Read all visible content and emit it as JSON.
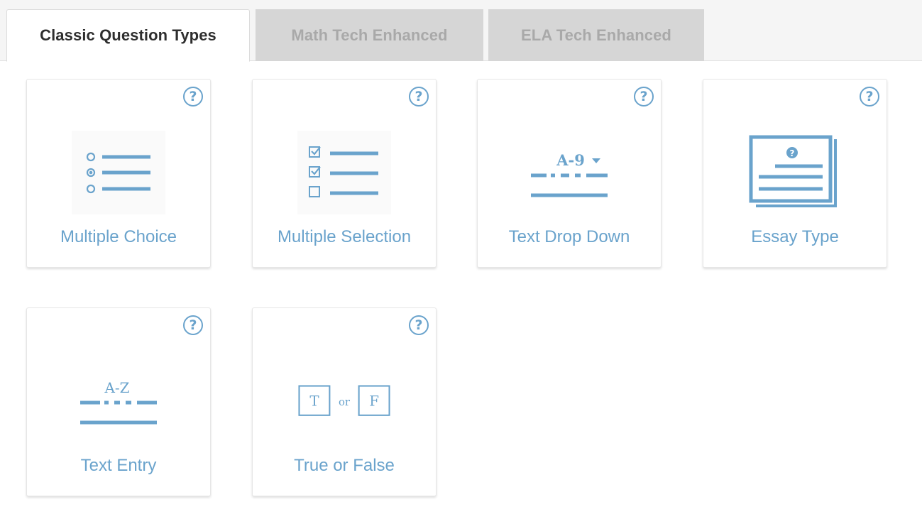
{
  "tabs": [
    {
      "label": "Classic Question Types",
      "active": true
    },
    {
      "label": "Math Tech Enhanced",
      "active": false
    },
    {
      "label": "ELA Tech Enhanced",
      "active": false
    }
  ],
  "help_glyph": "?",
  "cards": [
    {
      "label": "Multiple Choice",
      "icon": "multiple-choice-icon"
    },
    {
      "label": "Multiple Selection",
      "icon": "multiple-selection-icon"
    },
    {
      "label": "Text Drop Down",
      "icon": "text-drop-down-icon",
      "icon_text": "A-9"
    },
    {
      "label": "Essay Type",
      "icon": "essay-type-icon"
    },
    {
      "label": "Text Entry",
      "icon": "text-entry-icon",
      "icon_text": "A-Z"
    },
    {
      "label": "True or False",
      "icon": "true-or-false-icon",
      "icon_text_true": "T",
      "icon_text_or": "or",
      "icon_text_false": "F"
    }
  ],
  "colors": {
    "accent": "#6aa3cc",
    "tab_inactive_bg": "#d6d6d6",
    "tab_inactive_text": "#a9a9a9",
    "active_tab_text": "#2e2e2e"
  }
}
